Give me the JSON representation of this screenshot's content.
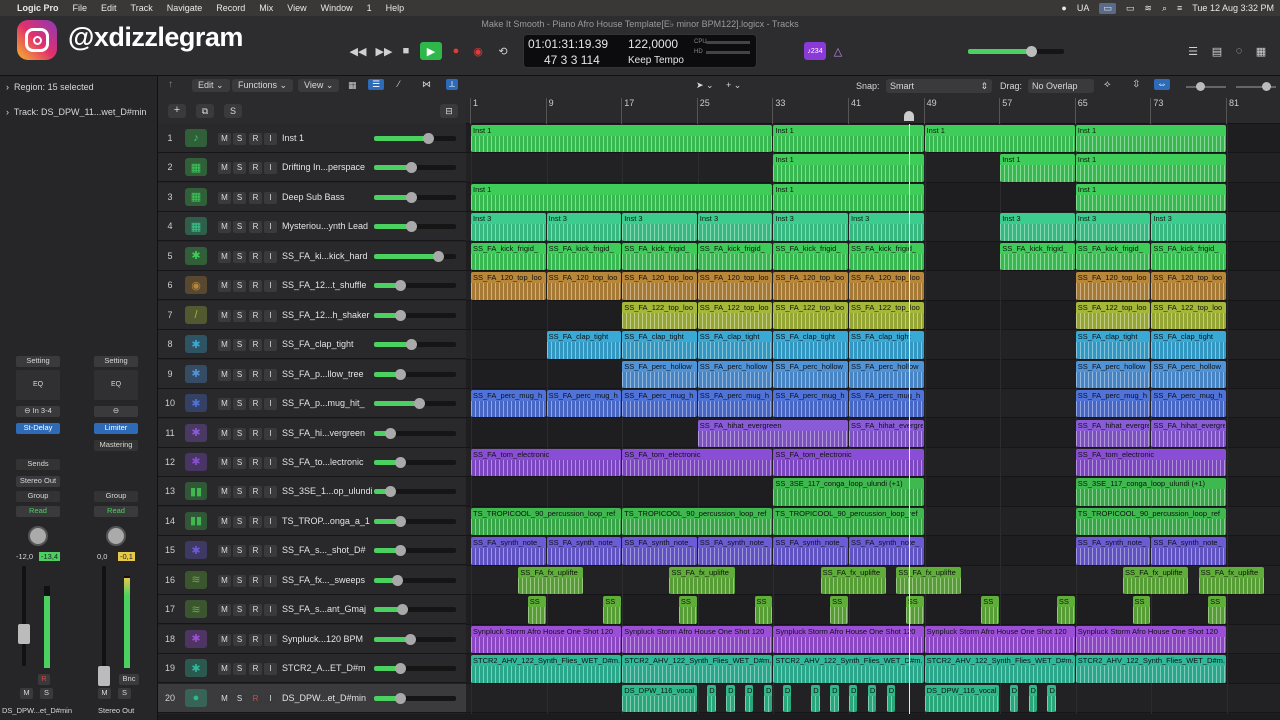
{
  "menubar": {
    "items": [
      "Logic Pro",
      "File",
      "Edit",
      "Track",
      "Navigate",
      "Record",
      "Mix",
      "View",
      "Window",
      "1",
      "Help"
    ],
    "right": {
      "lang": "UA",
      "datetime": "Tue 12 Aug  3:32 PM"
    }
  },
  "watermark": "@xdizzlegram",
  "window_title": "Make It Smooth - Piano Afro House Template[E♭ minor BPM122].logicx - Tracks",
  "transport": {
    "time": "01:01:31:19.39",
    "bars": "47  3  3  114",
    "tempo": "122,0000",
    "tempo_mode": "Keep Tempo",
    "key_badge": "♪234",
    "cpu": "CPU",
    "hd": "HD"
  },
  "inspector": {
    "region": "Region:",
    "region_value": "15 selected",
    "track": "Track:",
    "track_value": "DS_DPW_11...wet_D#min",
    "strip1": {
      "setting": "Setting",
      "eq": "EQ",
      "input": "In 3-4",
      "insert": "St-Delay",
      "sends": "Sends",
      "output": "Stereo Out",
      "group": "Group",
      "automation": "Read",
      "pan_l": "-12,0",
      "pan_r": "-13,4",
      "mute": "M",
      "solo": "S",
      "rec": "R",
      "name": "DS_DPW...et_D#min"
    },
    "strip2": {
      "setting": "Setting",
      "eq": "EQ",
      "insert": "Limiter",
      "insert2": "Mastering",
      "group": "Group",
      "automation": "Read",
      "pan_l": "0,0",
      "pan_r": "-0,1",
      "bounce": "Bnc",
      "mute": "M",
      "solo": "S",
      "name": "Stereo Out"
    }
  },
  "header_tools": {
    "edit": "Edit",
    "functions": "Functions",
    "view": "View",
    "add": "+",
    "s": "S"
  },
  "arrange_tools": {
    "snap_label": "Snap:",
    "snap_value": "Smart",
    "drag_label": "Drag:",
    "drag_value": "No Overlap"
  },
  "ruler": {
    "bars": [
      "1",
      "9",
      "17",
      "25",
      "33",
      "41",
      "49",
      "57",
      "65",
      "73",
      "81"
    ]
  },
  "tracks": [
    {
      "num": "1",
      "name": "Inst 1",
      "color": "#3fcd5a",
      "icon": "♪"
    },
    {
      "num": "2",
      "name": "Drifting In...perspace",
      "color": "#3fcd5a",
      "icon": "▦"
    },
    {
      "num": "3",
      "name": "Deep Sub Bass",
      "color": "#3fcd5a",
      "icon": "▦"
    },
    {
      "num": "4",
      "name": "Mysteriou...ynth Lead",
      "color": "#3ccc8e",
      "icon": "▦"
    },
    {
      "num": "5",
      "name": "SS_FA_ki...kick_hard",
      "color": "#3fcd5a",
      "icon": "✱"
    },
    {
      "num": "6",
      "name": "SS_FA_12...t_shuffle",
      "color": "#b8873a",
      "icon": "◉"
    },
    {
      "num": "7",
      "name": "SS_FA_12...h_shaker",
      "color": "#a6b83a",
      "icon": "/"
    },
    {
      "num": "8",
      "name": "SS_FA_clap_tight",
      "color": "#39a9d6",
      "icon": "✱"
    },
    {
      "num": "9",
      "name": "SS_FA_p...llow_tree",
      "color": "#4f93d9",
      "icon": "✱"
    },
    {
      "num": "10",
      "name": "SS_FA_p...mug_hit_",
      "color": "#4f73d9",
      "icon": "✱"
    },
    {
      "num": "11",
      "name": "SS_FA_hi...vergreen",
      "color": "#8a5bd6",
      "icon": "✱"
    },
    {
      "num": "12",
      "name": "SS_FA_to...lectronic",
      "color": "#8a4ed6",
      "icon": "✱"
    },
    {
      "num": "13",
      "name": "SS_3SE_1...op_ulundi",
      "color": "#3fb850",
      "icon": "▮▮"
    },
    {
      "num": "14",
      "name": "TS_TROP...onga_a_1",
      "color": "#3fb850",
      "icon": "▮▮"
    },
    {
      "num": "15",
      "name": "SS_FA_s..._shot_D#",
      "color": "#6a5bd6",
      "icon": "✱"
    },
    {
      "num": "16",
      "name": "SS_FA_fx..._sweeps",
      "color": "#5fae3a",
      "icon": "≋"
    },
    {
      "num": "17",
      "name": "SS_FA_s...ant_Gmaj",
      "color": "#5fae3a",
      "icon": "≋"
    },
    {
      "num": "18",
      "name": "Synpluck...120 BPM",
      "color": "#9a4fd6",
      "icon": "✱"
    },
    {
      "num": "19",
      "name": "STCR2_A...ET_D#m",
      "color": "#2fb89a",
      "icon": "✱"
    },
    {
      "num": "20",
      "name": "DS_DPW...et_D#min",
      "color": "#2fb889",
      "icon": "●"
    }
  ],
  "regions": [
    {
      "t": 0,
      "label": "Inst 1",
      "color": "#3fcd5a",
      "spans": [
        [
          1,
          33
        ],
        [
          33,
          49
        ],
        [
          49,
          65
        ],
        [
          65,
          81
        ]
      ]
    },
    {
      "t": 1,
      "label": "Inst 1",
      "color": "#3fcd5a",
      "spans": [
        [
          33,
          49
        ],
        [
          57,
          65
        ],
        [
          65,
          81
        ]
      ]
    },
    {
      "t": 2,
      "label": "Inst 1",
      "color": "#3fcd5a",
      "spans": [
        [
          1,
          33
        ],
        [
          33,
          49
        ],
        [
          65,
          81
        ]
      ]
    },
    {
      "t": 3,
      "label": "Inst 3",
      "color": "#3ccc8e",
      "spans": [
        [
          1,
          9
        ],
        [
          9,
          17
        ],
        [
          17,
          25
        ],
        [
          25,
          33
        ],
        [
          33,
          41
        ],
        [
          41,
          49
        ],
        [
          57,
          65
        ],
        [
          65,
          73
        ],
        [
          73,
          81
        ]
      ]
    },
    {
      "t": 4,
      "label": "SS_FA_kick_frigid_",
      "color": "#3fcd5a",
      "spans": [
        [
          1,
          9
        ],
        [
          9,
          17
        ],
        [
          17,
          25
        ],
        [
          25,
          33
        ],
        [
          33,
          41
        ],
        [
          41,
          49
        ],
        [
          57,
          65
        ],
        [
          65,
          73
        ],
        [
          73,
          81
        ]
      ]
    },
    {
      "t": 5,
      "label": "SS_FA_120_top_loo",
      "color": "#b8873a",
      "spans": [
        [
          1,
          9
        ],
        [
          9,
          17
        ],
        [
          17,
          25
        ],
        [
          25,
          33
        ],
        [
          33,
          41
        ],
        [
          41,
          49
        ],
        [
          65,
          73
        ],
        [
          73,
          81
        ]
      ]
    },
    {
      "t": 6,
      "label": "SS_FA_122_top_loo",
      "color": "#a6b83a",
      "spans": [
        [
          17,
          25
        ],
        [
          25,
          33
        ],
        [
          33,
          41
        ],
        [
          41,
          49
        ],
        [
          65,
          73
        ],
        [
          73,
          81
        ]
      ]
    },
    {
      "t": 7,
      "label": "SS_FA_clap_tight",
      "color": "#39a9d6",
      "spans": [
        [
          9,
          17
        ],
        [
          17,
          25
        ],
        [
          25,
          33
        ],
        [
          33,
          41
        ],
        [
          41,
          49
        ],
        [
          65,
          73
        ],
        [
          73,
          81
        ]
      ]
    },
    {
      "t": 8,
      "label": "SS_FA_perc_hollow",
      "color": "#4f93d9",
      "spans": [
        [
          17,
          25
        ],
        [
          25,
          33
        ],
        [
          33,
          41
        ],
        [
          41,
          49
        ],
        [
          65,
          73
        ],
        [
          73,
          81
        ]
      ]
    },
    {
      "t": 9,
      "label": "SS_FA_perc_mug_h",
      "color": "#4f73d9",
      "spans": [
        [
          1,
          9
        ],
        [
          9,
          17
        ],
        [
          17,
          25
        ],
        [
          25,
          33
        ],
        [
          33,
          41
        ],
        [
          41,
          49
        ],
        [
          65,
          73
        ],
        [
          73,
          81
        ]
      ]
    },
    {
      "t": 10,
      "label": "SS_FA_hihat_evergreen",
      "color": "#8a5bd6",
      "spans": [
        [
          25,
          41
        ],
        [
          41,
          49
        ],
        [
          65,
          73
        ],
        [
          73,
          81
        ]
      ]
    },
    {
      "t": 11,
      "label": "SS_FA_tom_electronic",
      "color": "#8a4ed6",
      "spans": [
        [
          1,
          17
        ],
        [
          17,
          33
        ],
        [
          33,
          49
        ],
        [
          65,
          81
        ]
      ]
    },
    {
      "t": 12,
      "label": "SS_3SE_117_conga_loop_ulundi (+1)",
      "color": "#3fb850",
      "spans": [
        [
          33,
          49
        ],
        [
          65,
          81
        ]
      ]
    },
    {
      "t": 13,
      "label": "TS_TROPICOOL_90_percussion_loop_ref",
      "color": "#3fb850",
      "spans": [
        [
          1,
          17
        ],
        [
          17,
          33
        ],
        [
          33,
          49
        ],
        [
          65,
          81
        ]
      ]
    },
    {
      "t": 14,
      "label": "SS_FA_synth_note_",
      "color": "#6a5bd6",
      "spans": [
        [
          1,
          9
        ],
        [
          9,
          17
        ],
        [
          17,
          25
        ],
        [
          25,
          33
        ],
        [
          33,
          41
        ],
        [
          41,
          49
        ],
        [
          65,
          73
        ],
        [
          73,
          81
        ]
      ]
    },
    {
      "t": 15,
      "label": "SS_FA_fx_uplifte",
      "color": "#5fae3a",
      "spans": [
        [
          6,
          13
        ],
        [
          22,
          29
        ],
        [
          38,
          45
        ],
        [
          46,
          53
        ],
        [
          70,
          77
        ],
        [
          78,
          85
        ]
      ]
    },
    {
      "t": 16,
      "label": "SS",
      "color": "#5fae3a",
      "spans": [
        [
          7,
          9
        ],
        [
          15,
          17
        ],
        [
          23,
          25
        ],
        [
          31,
          33
        ],
        [
          39,
          41
        ],
        [
          47,
          49
        ],
        [
          55,
          57
        ],
        [
          63,
          65
        ],
        [
          71,
          73
        ],
        [
          79,
          81
        ]
      ]
    },
    {
      "t": 17,
      "label": "Synpluck Storm Afro House One Shot 120",
      "color": "#9a4fd6",
      "spans": [
        [
          1,
          17
        ],
        [
          17,
          33
        ],
        [
          33,
          49
        ],
        [
          49,
          65
        ],
        [
          65,
          81
        ]
      ]
    },
    {
      "t": 18,
      "label": "STCR2_AHV_122_Synth_Flies_WET_D#m.",
      "color": "#2fb89a",
      "spans": [
        [
          1,
          17
        ],
        [
          17,
          33
        ],
        [
          33,
          49
        ],
        [
          49,
          65
        ],
        [
          65,
          81
        ]
      ]
    },
    {
      "t": 19,
      "label": "DS_DPW_116_vocal",
      "color": "#2fb889",
      "spans": [
        [
          17,
          25
        ],
        [
          26,
          27
        ],
        [
          28,
          29
        ],
        [
          30,
          31
        ],
        [
          32,
          33
        ],
        [
          34,
          35
        ],
        [
          37,
          38
        ],
        [
          39,
          40
        ],
        [
          41,
          42
        ],
        [
          43,
          44
        ],
        [
          45,
          46
        ],
        [
          49,
          57
        ],
        [
          58,
          59
        ],
        [
          60,
          61
        ],
        [
          62,
          63
        ]
      ]
    }
  ]
}
